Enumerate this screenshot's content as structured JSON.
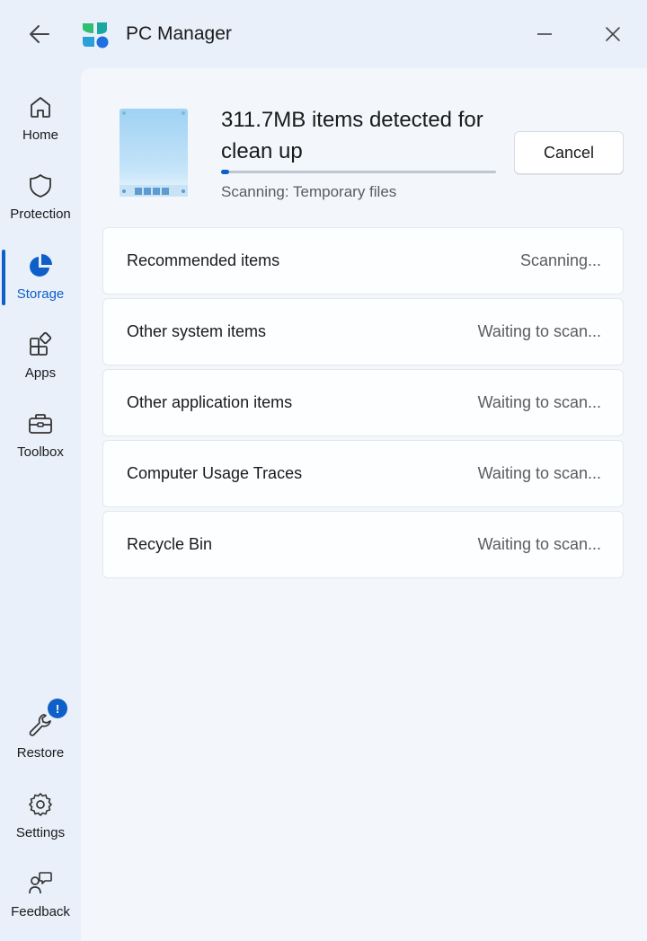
{
  "app": {
    "title": "PC Manager"
  },
  "sidebar": {
    "top_items": [
      {
        "label": "Home",
        "icon": "home-icon"
      },
      {
        "label": "Protection",
        "icon": "shield-icon"
      },
      {
        "label": "Storage",
        "icon": "pie-chart-icon",
        "active": true
      },
      {
        "label": "Apps",
        "icon": "apps-icon"
      },
      {
        "label": "Toolbox",
        "icon": "toolbox-icon"
      }
    ],
    "bottom_items": [
      {
        "label": "Restore",
        "icon": "wrench-icon",
        "badge": "!"
      },
      {
        "label": "Settings",
        "icon": "gear-icon"
      },
      {
        "label": "Feedback",
        "icon": "feedback-icon"
      }
    ]
  },
  "scan": {
    "title": "311.7MB items detected for clean up",
    "status": "Scanning: Temporary files",
    "progress": 0.03,
    "cancel_label": "Cancel"
  },
  "items": [
    {
      "label": "Recommended items",
      "status": "Scanning..."
    },
    {
      "label": "Other system items",
      "status": "Waiting to scan..."
    },
    {
      "label": "Other application items",
      "status": "Waiting to scan..."
    },
    {
      "label": "Computer Usage Traces",
      "status": "Waiting to scan..."
    },
    {
      "label": "Recycle Bin",
      "status": "Waiting to scan..."
    }
  ],
  "colors": {
    "accent": "#0f5fc9",
    "background": "#e9f0fa",
    "content_background": "#f3f6fb"
  }
}
